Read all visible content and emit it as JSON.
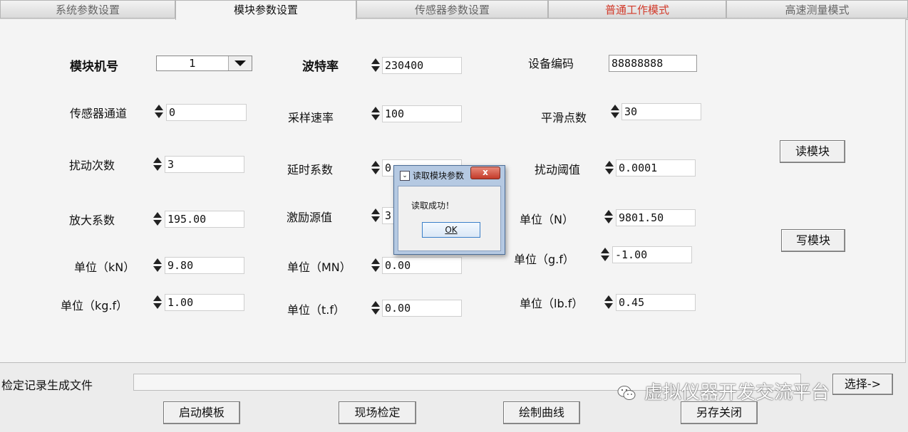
{
  "tabs": [
    {
      "label": "系统参数设置"
    },
    {
      "label": "模块参数设置"
    },
    {
      "label": "传感器参数设置"
    },
    {
      "label": "普通工作模式"
    },
    {
      "label": "高速测量模式"
    }
  ],
  "params": {
    "module_no": {
      "label": "模块机号",
      "value": "1"
    },
    "baud_rate": {
      "label": "波特率",
      "value": "230400"
    },
    "device_code": {
      "label": "设备编码",
      "value": "88888888"
    },
    "sensor_channel": {
      "label": "传感器通道",
      "value": "0"
    },
    "sample_rate": {
      "label": "采样速率",
      "value": "100"
    },
    "smooth_points": {
      "label": "平滑点数",
      "value": "30"
    },
    "disturb_count": {
      "label": "扰动次数",
      "value": "3"
    },
    "delay_coef": {
      "label": "延时系数",
      "value": "0."
    },
    "disturb_threshold": {
      "label": "扰动阈值",
      "value": "0.0001"
    },
    "gain_coef": {
      "label": "放大系数",
      "value": "195.00"
    },
    "excitation": {
      "label": "激励源值",
      "value": "3."
    },
    "unit_n": {
      "label": "单位（N）",
      "value": "9801.50"
    },
    "unit_kn": {
      "label": "单位（kN）",
      "value": "9.80"
    },
    "unit_mn": {
      "label": "单位（MN）",
      "value": "0.00"
    },
    "unit_gf": {
      "label": "单位（g.f）",
      "value": "-1.00"
    },
    "unit_kgf": {
      "label": "单位（kg.f）",
      "value": "1.00"
    },
    "unit_tf": {
      "label": "单位（t.f）",
      "value": "0.00"
    },
    "unit_lbf": {
      "label": "单位（lb.f）",
      "value": "0.45"
    }
  },
  "buttons": {
    "read_module": "读模块",
    "write_module": "写模块",
    "start_template": "启动模板",
    "field_check": "现场检定",
    "draw_curve": "绘制曲线",
    "save_close": "另存关闭",
    "select": "选择->"
  },
  "record_file": {
    "label": "检定记录生成文件",
    "path": ""
  },
  "dialog": {
    "title": "读取模块参数",
    "close": "x",
    "message": "读取成功！",
    "ok": "OK"
  },
  "watermark": "虚拟仪器开发交流平台",
  "colors": {
    "active_tab_text": "#111111",
    "mode_tab_text": "#d23a2a"
  }
}
